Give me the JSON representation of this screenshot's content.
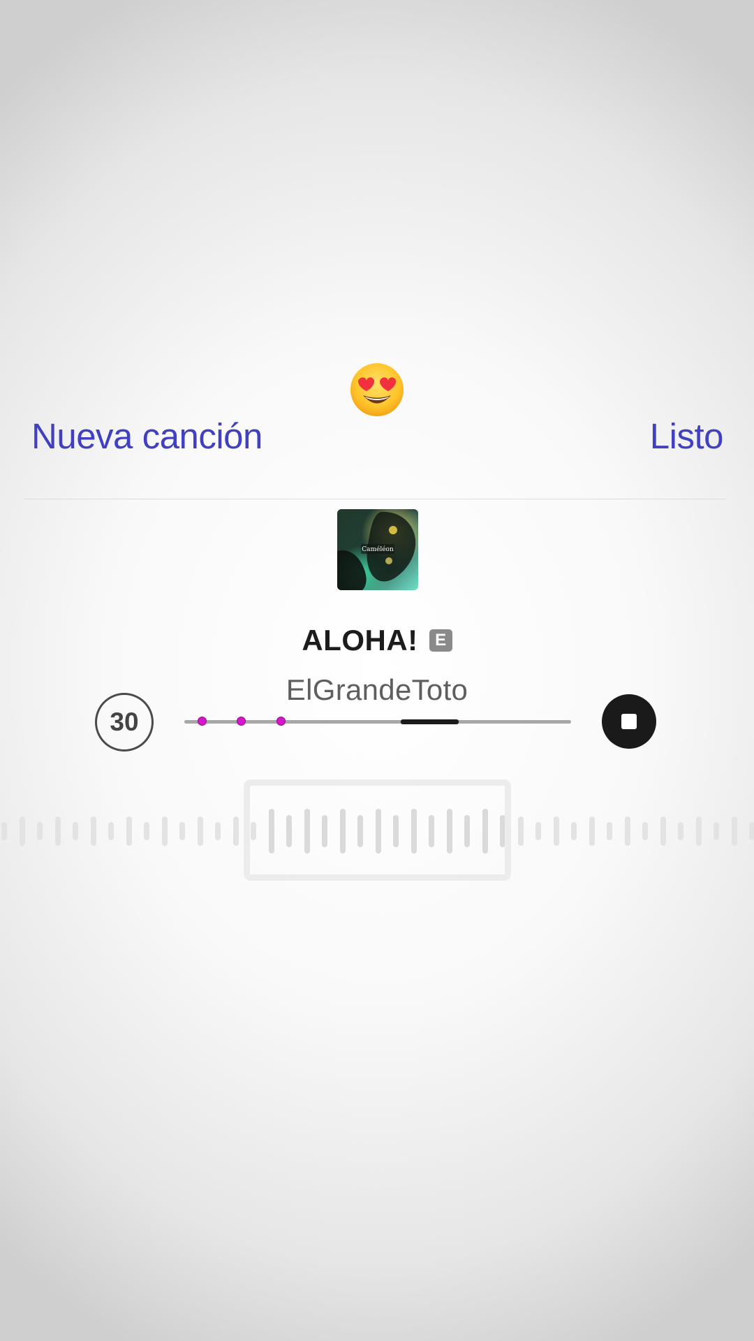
{
  "header": {
    "reaction_emoji": "heart-eyes-emoji",
    "new_song_label": "Nueva canción",
    "done_label": "Listo",
    "accent_color": "#4040c0"
  },
  "song": {
    "title": "ALOHA!",
    "explicit_badge": "E",
    "artist": "ElGrandeToto",
    "artwork_text": "Caméléon"
  },
  "player": {
    "skip_label": "30",
    "stop_icon": "stop-icon",
    "selection_start_fraction": 0.56,
    "selection_end_fraction": 0.71,
    "markers_fraction": [
      0.045,
      0.147,
      0.249
    ],
    "marker_color": "#d318cc"
  }
}
